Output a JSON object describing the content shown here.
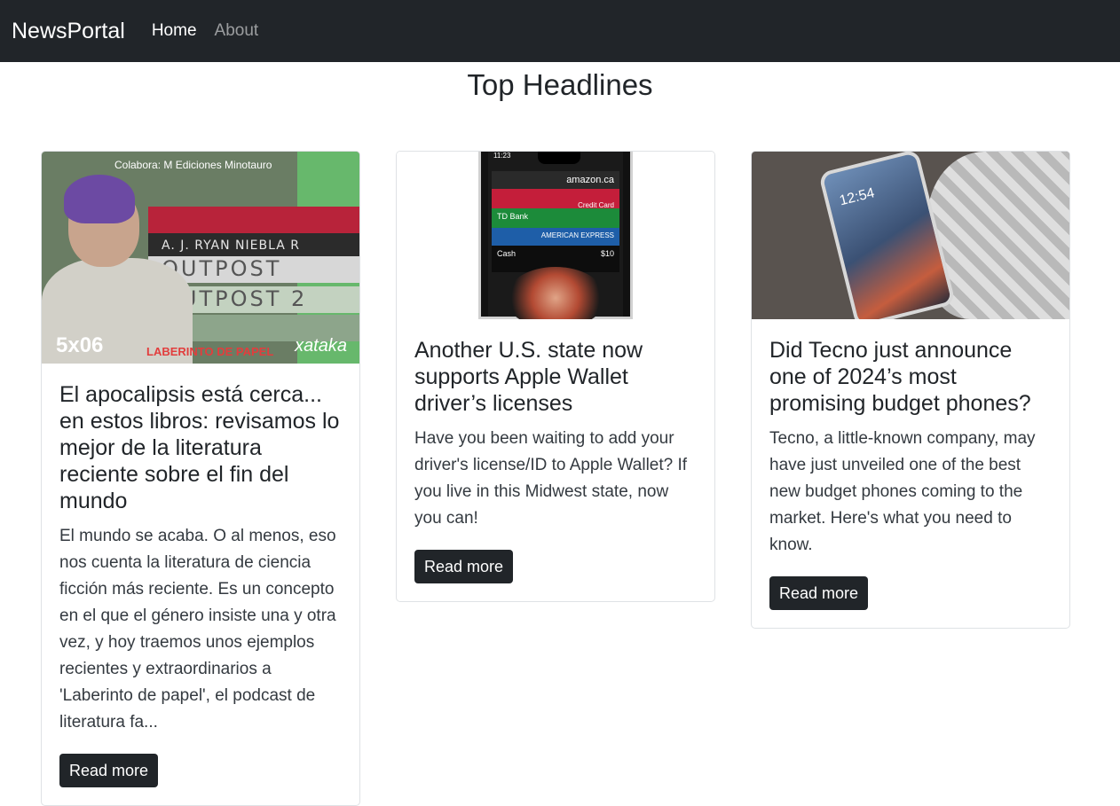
{
  "navbar": {
    "brand": "NewsPortal",
    "links": [
      "Home",
      "About"
    ],
    "active": "Home",
    "bg_color": "#212529"
  },
  "main": {
    "title": "Top Headlines",
    "articles": [
      {
        "title": "El apocalipsis está cerca... en estos libros: revisamos lo mejor de la literatura reciente sobre el fin del mundo",
        "description": "El mundo se acaba. O al menos, eso nos cuenta la literatura de ciencia ficción más reciente. Es un concepto en el que el género insiste una y otra vez, y hoy traemos unos ejemplos recientes y extraordinarios a 'Laberinto de papel', el podcast de literatura fa...",
        "button": "Read more",
        "image": {
          "overlay_top": "Colabora: M Ediciones Minotauro",
          "episode": "5x06",
          "label": "LABERINTO DE PAPEL",
          "brand": "xataka",
          "books": [
            "A. J. RYAN   NIEBLA R",
            "OUTPOST",
            "OUTPOST 2"
          ]
        }
      },
      {
        "title": "Another U.S. state now supports Apple Wallet driver’s licenses",
        "description": "Have you been waiting to add your driver's license/ID to Apple Wallet? If you live in this Midwest state, now you can!",
        "button": "Read more",
        "image": {
          "time": "11:23",
          "cards": [
            "amazon.ca",
            "Credit Card",
            "TD Bank",
            "AMERICAN EXPRESS",
            "Cash",
            "$10"
          ]
        }
      },
      {
        "title": "Did Tecno just announce one of 2024’s most promising budget phones?",
        "description": "Tecno, a little-known company, may have just unveiled one of the best new budget phones coming to the market. Here's what you need to know.",
        "button": "Read more",
        "image": {
          "clock": "12:54"
        }
      }
    ]
  }
}
